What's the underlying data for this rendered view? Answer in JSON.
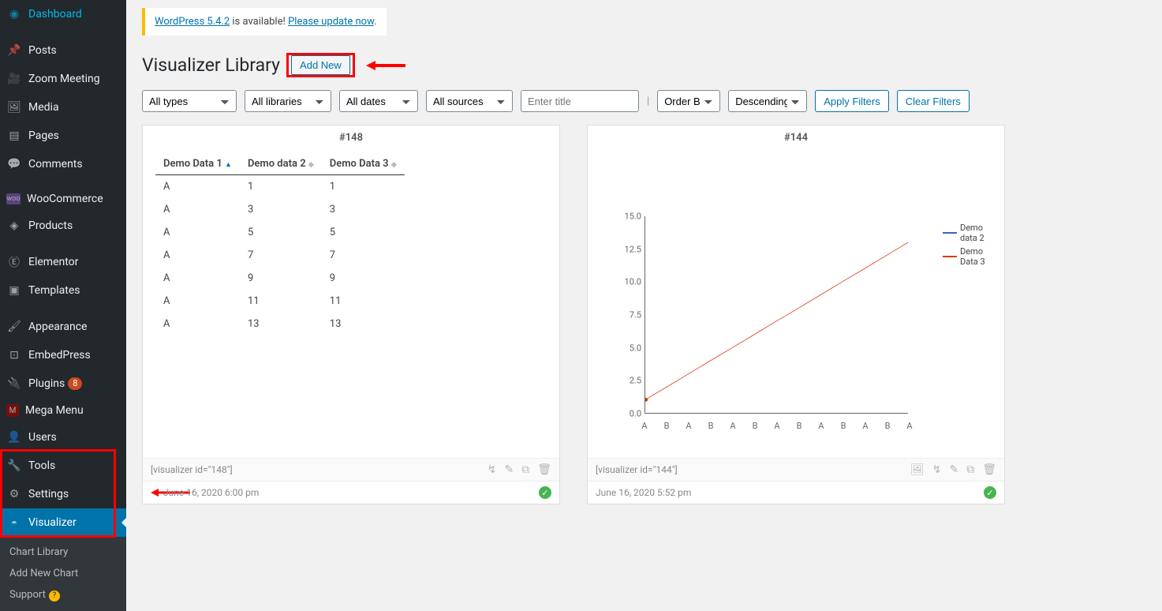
{
  "sidebar": {
    "items": [
      {
        "label": "Dashboard",
        "icon": "◉"
      },
      {
        "label": "Posts",
        "icon": "✎"
      },
      {
        "label": "Zoom Meeting",
        "icon": "■"
      },
      {
        "label": "Media",
        "icon": "❐"
      },
      {
        "label": "Pages",
        "icon": "▤"
      },
      {
        "label": "Comments",
        "icon": "💬"
      },
      {
        "label": "WooCommerce",
        "icon": "W"
      },
      {
        "label": "Products",
        "icon": "◈"
      },
      {
        "label": "Elementor",
        "icon": "E"
      },
      {
        "label": "Templates",
        "icon": "▣"
      },
      {
        "label": "Appearance",
        "icon": "✦"
      },
      {
        "label": "EmbedPress",
        "icon": "⊡"
      },
      {
        "label": "Plugins",
        "icon": "🔌",
        "badge": "8"
      },
      {
        "label": "Mega Menu",
        "icon": "M"
      },
      {
        "label": "Users",
        "icon": "👤"
      },
      {
        "label": "Tools",
        "icon": "🔧"
      },
      {
        "label": "Settings",
        "icon": "⚙"
      },
      {
        "label": "Visualizer",
        "icon": "◓",
        "active": true
      }
    ],
    "submenu": [
      {
        "label": "Chart Library"
      },
      {
        "label": "Add New Chart"
      },
      {
        "label": "Support",
        "help": "?"
      }
    ]
  },
  "notice": {
    "link1": "WordPress 5.4.2",
    "mid": " is available! ",
    "link2": "Please update now",
    "end": "."
  },
  "page": {
    "title": "Visualizer Library",
    "add_new": "Add New"
  },
  "filters": {
    "types": "All types",
    "libraries": "All libraries",
    "dates": "All dates",
    "sources": "All sources",
    "title_placeholder": "Enter title",
    "orderby": "Order By",
    "direction": "Descending",
    "apply": "Apply Filters",
    "clear": "Clear Filters"
  },
  "card1": {
    "id": "#148",
    "cols": [
      "Demo Data 1",
      "Demo data 2",
      "Demo Data 3"
    ],
    "rows": [
      [
        "A",
        "1",
        "1"
      ],
      [
        "A",
        "3",
        "3"
      ],
      [
        "A",
        "5",
        "5"
      ],
      [
        "A",
        "7",
        "7"
      ],
      [
        "A",
        "9",
        "9"
      ],
      [
        "A",
        "11",
        "11"
      ],
      [
        "A",
        "13",
        "13"
      ]
    ],
    "shortcode": "[visualizer id=\"148\"]",
    "date": "June 16, 2020 6:00 pm"
  },
  "card2": {
    "id": "#144",
    "legend": [
      "Demo data 2",
      "Demo Data 3"
    ],
    "yticks": [
      "0.0",
      "2.5",
      "5.0",
      "7.5",
      "10.0",
      "12.5",
      "15.0"
    ],
    "xticks": [
      "A",
      "B",
      "A",
      "B",
      "A",
      "B",
      "A",
      "B",
      "A",
      "B",
      "A",
      "B",
      "A"
    ],
    "shortcode": "[visualizer id=\"144\"]",
    "date": "June 16, 2020 5:52 pm"
  },
  "chart_data": [
    {
      "type": "table",
      "title": "#148",
      "columns": [
        "Demo Data 1",
        "Demo data 2",
        "Demo Data 3"
      ],
      "rows": [
        [
          "A",
          1,
          1
        ],
        [
          "A",
          3,
          3
        ],
        [
          "A",
          5,
          5
        ],
        [
          "A",
          7,
          7
        ],
        [
          "A",
          9,
          9
        ],
        [
          "A",
          11,
          11
        ],
        [
          "A",
          13,
          13
        ]
      ]
    },
    {
      "type": "line",
      "title": "#144",
      "x": [
        "A",
        "B",
        "A",
        "B",
        "A",
        "B",
        "A",
        "B",
        "A",
        "B",
        "A",
        "B",
        "A"
      ],
      "series": [
        {
          "name": "Demo data 2",
          "values": [
            1,
            2,
            3,
            4,
            5,
            6,
            7,
            8,
            9,
            10,
            11,
            12,
            13
          ],
          "color": "#3366cc"
        },
        {
          "name": "Demo Data 3",
          "values": [
            1,
            2,
            3,
            4,
            5,
            6,
            7,
            8,
            9,
            10,
            11,
            12,
            13
          ],
          "color": "#dc3912"
        }
      ],
      "ylim": [
        0,
        15
      ],
      "yticks": [
        0.0,
        2.5,
        5.0,
        7.5,
        10.0,
        12.5,
        15.0
      ]
    }
  ]
}
